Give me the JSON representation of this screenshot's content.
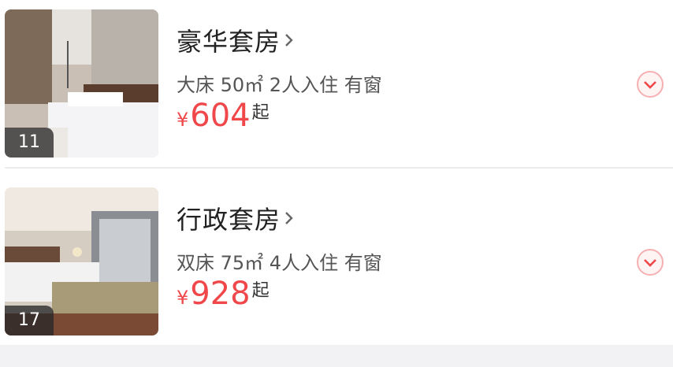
{
  "rooms": [
    {
      "name": "豪华套房",
      "info": "大床 50㎡ 2人入住 有窗",
      "price_currency": "¥",
      "price": "604",
      "price_suffix": "起",
      "photo_count": "11"
    },
    {
      "name": "行政套房",
      "info": "双床 75㎡ 4人入住 有窗",
      "price_currency": "¥",
      "price": "928",
      "price_suffix": "起",
      "photo_count": "17"
    }
  ],
  "icons": {
    "detail": "chevron-right-icon",
    "expand": "chevron-down-circle-icon"
  },
  "colors": {
    "price": "#f0474a",
    "expand_accent": "#f27a7e"
  }
}
